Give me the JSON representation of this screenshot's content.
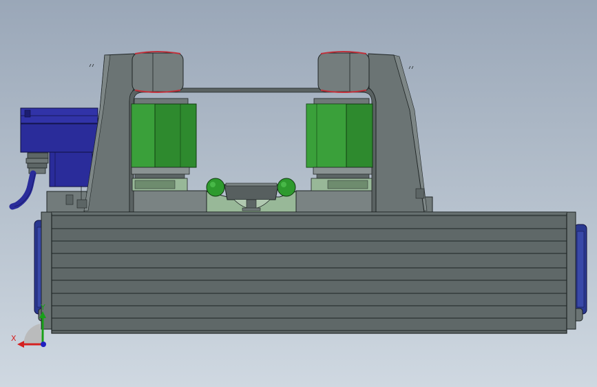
{
  "view": {
    "background_top": "#9aa7b8",
    "background_bottom": "#cfd8e1"
  },
  "model": {
    "colors": {
      "frame": "#6b7474",
      "frame_dark": "#4e5656",
      "edge": "#1e2424",
      "motor_green": "#2e8a2e",
      "motor_green_dark": "#1f6a1f",
      "motor_green_light": "#3aa03a",
      "pale_green": "#98b898",
      "blue_box": "#2a2c9a",
      "blue_dark": "#1c1d70",
      "red_seam": "#c0303a",
      "roller_grey": "#707878"
    },
    "parts": [
      "base-extrusion",
      "left-column",
      "right-column",
      "left-motor",
      "right-motor",
      "left-cap",
      "right-cap",
      "center-guide",
      "left-ball",
      "right-ball",
      "side-junction-box",
      "cable-gland",
      "cable",
      "left-end-cap",
      "right-end-cap"
    ]
  },
  "triad": {
    "x_label": "X",
    "y_label": "Y",
    "x_color": "#d42020",
    "y_color": "#18a018",
    "z_color": "#2020c0"
  }
}
